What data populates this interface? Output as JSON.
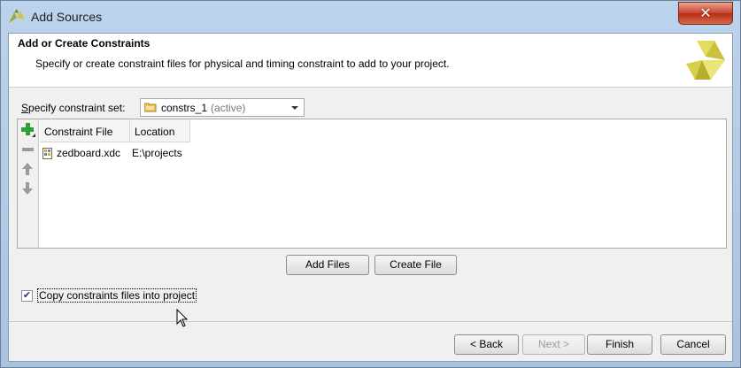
{
  "window": {
    "title": "Add Sources",
    "close_glyph": "✕"
  },
  "header": {
    "title": "Add or Create Constraints",
    "description": "Specify or create constraint files for physical and timing constraint to add to your project.",
    "logo_icon": "vivado-logo"
  },
  "constraint_set": {
    "label_mnemonic": "S",
    "label_rest": "pecify constraint set:",
    "value": "constrs_1",
    "status": "(active)"
  },
  "table": {
    "columns": [
      "Constraint File",
      "Location"
    ],
    "rows": [
      {
        "file": "zedboard.xdc",
        "location": "E:\\projects"
      }
    ],
    "toolbar_icons": [
      "add-icon",
      "remove-icon",
      "move-up-icon",
      "move-down-icon"
    ]
  },
  "buttons": {
    "add_files": "Add Files",
    "create_file": "Create File",
    "back": "< Back",
    "next": "Next >",
    "finish": "Finish",
    "cancel": "Cancel"
  },
  "copy_option": {
    "checked": true,
    "check_glyph": "✔",
    "label": "Copy constraints files into project"
  },
  "colors": {
    "accent_green": "#2e9d3a",
    "logo_yellow": "#d4c84a",
    "close_red": "#c8412a"
  }
}
